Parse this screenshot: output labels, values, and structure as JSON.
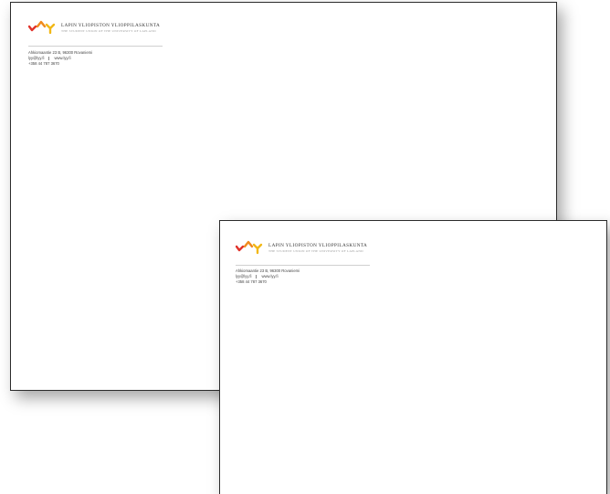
{
  "organization": {
    "name": "LAPIN YLIOPISTON YLIOPPILASKUNTA",
    "name_en": "THE STUDENT UNION OF THE UNIVERSITY OF LAPLAND",
    "logo_icon": "lyy-logo-icon"
  },
  "address": {
    "street": "Ahkiomaantie 23 B, 96300 Rovaniemi",
    "email": "lyy@lyy.fi",
    "web": "www.lyy.fi",
    "phone": "+358 44 787 3670"
  },
  "colors": {
    "logo_red": "#e1332b",
    "logo_orange": "#f08a1c",
    "logo_yellow": "#f2b817",
    "border": "#2b2b2b"
  }
}
